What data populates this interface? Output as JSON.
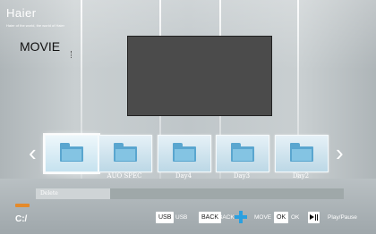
{
  "brand": {
    "logo": "Haier",
    "tagline": "Haier of the world, the world of Haier"
  },
  "page": {
    "title": "MOVIE"
  },
  "items": [
    {
      "label": "",
      "selected": true
    },
    {
      "label": "AUO SPEC",
      "selected": false
    },
    {
      "label": "Day4",
      "selected": false
    },
    {
      "label": "Day3",
      "selected": false
    },
    {
      "label": "Day2",
      "selected": false
    }
  ],
  "delete_bar": {
    "label": "Delete",
    "progress_fraction": 0.24
  },
  "path": "C:/",
  "hints": {
    "usb_key": "USB",
    "usb_label": "USB",
    "back_key": "BACK",
    "back_label": "BACK",
    "move_label": "MOVE",
    "ok_key": "OK",
    "ok_label": "OK",
    "play_label": "Play/Pause"
  },
  "icons": {
    "prev": "chevron-left-icon",
    "next": "chevron-right-icon",
    "folder": "folder-icon",
    "move": "dpad-cross-icon",
    "play": "play-pause-icon"
  },
  "colors": {
    "accent_orange": "#e48a2a",
    "folder_blue": "#5aa6cf",
    "move_blue": "#2aa0e0"
  }
}
